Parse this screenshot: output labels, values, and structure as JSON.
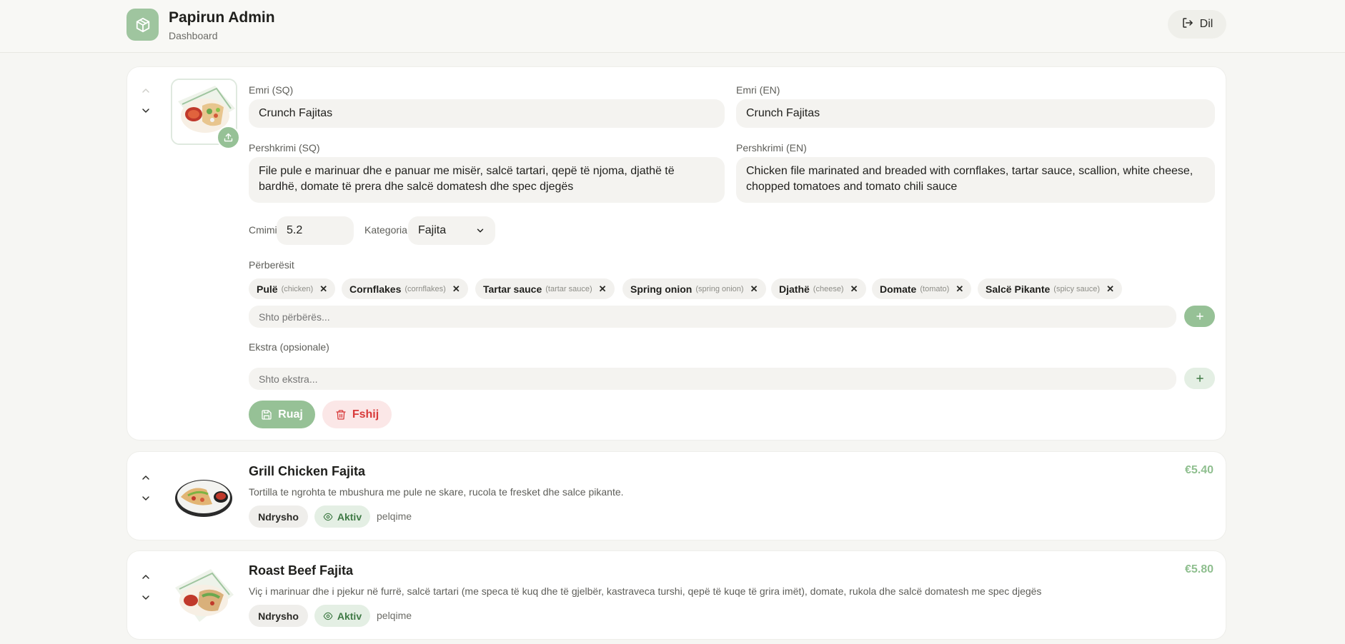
{
  "header": {
    "app_title": "Papirun Admin",
    "subtitle": "Dashboard",
    "logout_label": "Dil"
  },
  "colors": {
    "accent": "#96c196",
    "background": "#f6f6f3",
    "danger": "#d83a3a",
    "price": "#8fbf8f"
  },
  "edit_form": {
    "name_sq_label": "Emri (SQ)",
    "name_sq_value": "Crunch Fajitas",
    "name_en_label": "Emri (EN)",
    "name_en_value": "Crunch Fajitas",
    "desc_sq_label": "Pershkrimi (SQ)",
    "desc_sq_value": "File pule e marinuar dhe e panuar me misër, salcë tartari, qepë të njoma, djathë të bardhë, domate të prera dhe salcë domatesh dhe spec djegës",
    "desc_en_label": "Pershkrimi (EN)",
    "desc_en_value": "Chicken file marinated and breaded with cornflakes, tartar sauce, scallion, white cheese, chopped tomatoes and tomato chili sauce",
    "price_label": "Cmimi",
    "price_value": "5.2",
    "category_label": "Kategoria",
    "category_value": "Fajita",
    "ingredients_label": "Përberësit",
    "ingredients": [
      {
        "name": "Pulë",
        "translation": "(chicken)"
      },
      {
        "name": "Cornflakes",
        "translation": "(cornflakes)"
      },
      {
        "name": "Tartar sauce",
        "translation": "(tartar sauce)"
      },
      {
        "name": "Spring onion",
        "translation": "(spring onion)"
      },
      {
        "name": "Djathë",
        "translation": "(cheese)"
      },
      {
        "name": "Domate",
        "translation": "(tomato)"
      },
      {
        "name": "Salcë Pikante",
        "translation": "(spicy sauce)"
      }
    ],
    "ingredient_placeholder": "Shto përbërës...",
    "extras_label": "Ekstra (opsionale)",
    "extras_placeholder": "Shto ekstra...",
    "save_label": "Ruaj",
    "delete_label": "Fshij",
    "icons": [
      "chevron-up-icon",
      "chevron-down-icon",
      "upload-icon",
      "plus-icon",
      "close-icon",
      "save-icon",
      "trash-icon"
    ]
  },
  "items": [
    {
      "name": "Grill Chicken Fajita",
      "description": "Tortilla te ngrohta te mbushura me pule ne skare, rucola te fresket dhe salce pikante.",
      "price": "€5.40",
      "edit_label": "Ndrysho",
      "status_label": "Aktiv",
      "slug": "pelqime"
    },
    {
      "name": "Roast Beef Fajita",
      "description": "Viç i marinuar dhe i pjekur në furrë, salcë tartari (me speca të kuq dhe të gjelbër, kastraveca turshi, qepë të kuqe të grira imët), domate, rukola dhe salcë domatesh me spec djegës",
      "price": "€5.80",
      "edit_label": "Ndrysho",
      "status_label": "Aktiv",
      "slug": "pelqime"
    }
  ]
}
